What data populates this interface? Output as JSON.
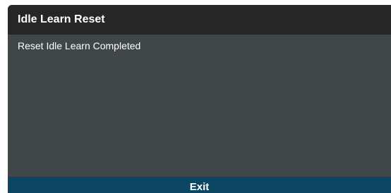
{
  "dialog": {
    "title": "Idle Learn Reset",
    "message": "Reset Idle Learn Completed",
    "exit_label": "Exit"
  },
  "colors": {
    "title_bar": "#242628",
    "body": "#40474b",
    "footer": "#0b4663",
    "text": "#ffffff"
  }
}
